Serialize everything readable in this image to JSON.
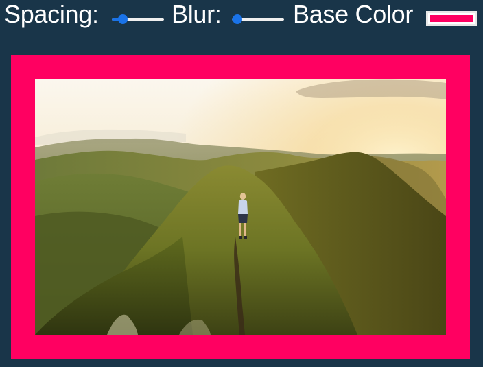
{
  "controls": {
    "spacing": {
      "label": "Spacing:",
      "value": 0.21
    },
    "blur": {
      "label": "Blur:",
      "value": 0.11
    },
    "base_color": {
      "label": "Base Color",
      "value": "#ff0061"
    }
  },
  "colors": {
    "background": "#193549",
    "accent": "#ff0061",
    "slider_active": "#1a73e8"
  },
  "image": {
    "icon": "mountain-ridge-hiker-photo"
  }
}
